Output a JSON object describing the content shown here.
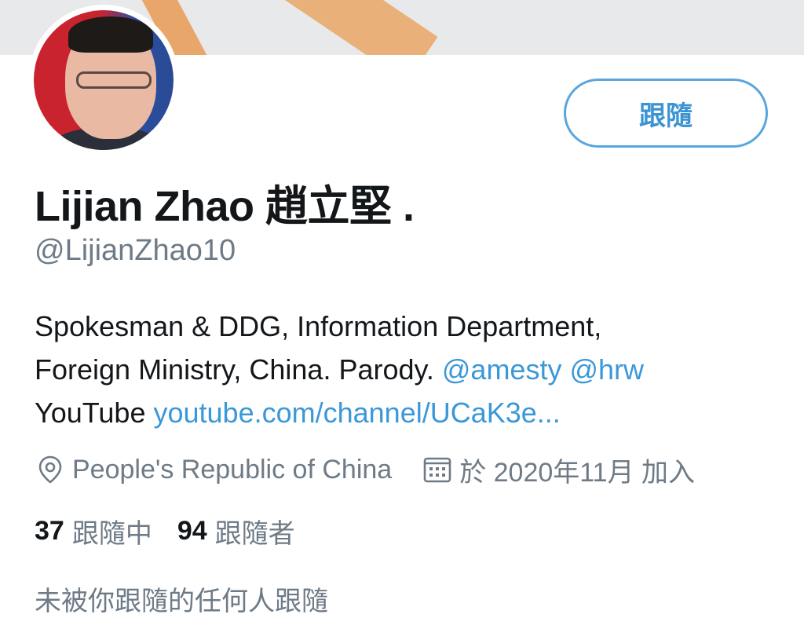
{
  "profile": {
    "name": "Lijian Zhao 趙立堅 .",
    "handle": "@LijianZhao10",
    "follow_button": "跟隨",
    "bio": {
      "line1": "Spokesman & DDG, Information Department,",
      "line2_text": "Foreign Ministry, China. Parody.",
      "mention1": "@amesty",
      "mention2": "@hrw",
      "line3_text": "YouTube",
      "youtube_link": "youtube.com/channel/UCaK3e..."
    },
    "location": "People's Republic of China",
    "joined": "於 2020年11月 加入",
    "following_count": "37",
    "following_label": "跟隨中",
    "followers_count": "94",
    "followers_label": "跟隨者",
    "followed_by": "未被你跟隨的任何人跟隨"
  },
  "icons": {
    "location": "location-pin-icon",
    "calendar": "calendar-icon"
  },
  "colors": {
    "accent": "#3b98d8",
    "secondary_text": "#6e7b87",
    "primary_text": "#14171a"
  }
}
